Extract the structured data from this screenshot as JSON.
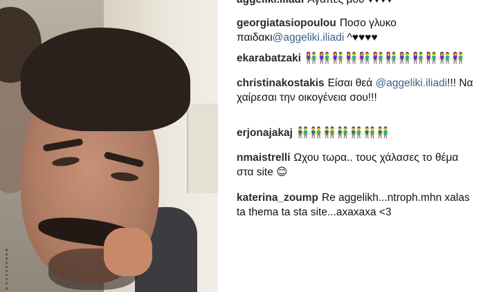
{
  "photo": {
    "alt": "selfie"
  },
  "comments": [
    {
      "user": "aggeliki.iliadi",
      "text": "Αγάπες μου ♥♥♥♥"
    },
    {
      "user": "georgiatasiopoulou",
      "text": "Ποσο γλυκο παιδακι",
      "mention": "@aggeliki.iliadi",
      "text_after": " ^♥♥♥♥"
    },
    {
      "user": "ekarabatzaki",
      "text": "👫👫👫👫👫👫👫👫👫👫👫👫"
    },
    {
      "user": "christinakostakis",
      "text": "Είσαι θεά",
      "mention": "@aggeliki.iliadi",
      "text_after": "!!! Να χαίρεσαι την οικογένεια σου!!!"
    },
    {
      "user": "erjonajakaj",
      "text": "👬👬👬👬👬👬👬"
    },
    {
      "user": "nmaistrelli",
      "text": "Ωχου τωρα.. τους χάλασες το θέμα στα site 😊"
    },
    {
      "user": "katerina_zoump",
      "text": "Re aggelikh...ntroph.mhn xalas ta thema ta sta site...axaxaxa <3"
    }
  ]
}
